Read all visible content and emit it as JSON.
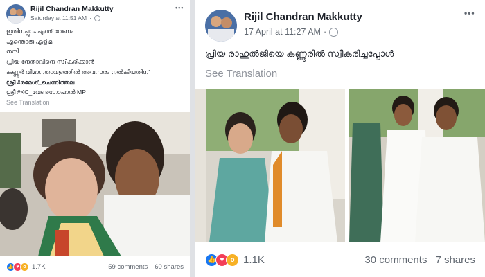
{
  "left_post": {
    "author": "Rijil Chandran Makkutty",
    "timestamp": "Saturday at 11:51 AM",
    "more_label": "•••",
    "text_lines": [
      "ഇതിനപ്പുറം എന്ത് വേണം",
      "എന്തൊരു എളിമ",
      "നന്ദി",
      "പ്രിയ നേതാവിനെ സ്വീകരിക്കാൻ",
      "കണ്ണൂർ വിമാനതാവളത്തിൽ അവസരം നൽകിയതിന്",
      "ശ്രീ #രമേശ്_ചെന്നിത്തല",
      "ശ്രീ #KC_വേണുഗോപാൽ MP"
    ],
    "see_translation": "See Translation",
    "reactions_count": "1.7K",
    "comments": "59 comments",
    "shares": "60 shares"
  },
  "right_post": {
    "author": "Rijil Chandran Makkutty",
    "timestamp": "17 April at 11:27 AM",
    "more_label": "•••",
    "text": "പ്രിയ രാഹുൽജിയെ കണ്ണൂരിൽ സ്വീകരിച്ചപ്പോൾ",
    "see_translation": "See Translation",
    "reactions_count": "1.1K",
    "comments": "30 comments",
    "shares": "7 shares"
  },
  "colors": {
    "like": "#1877f2",
    "love": "#f33e58",
    "wow": "#f7b125",
    "link": "#1d2129"
  },
  "icons": [
    "globe-icon",
    "more-options-icon",
    "like-reaction-icon",
    "love-reaction-icon",
    "wow-reaction-icon"
  ]
}
